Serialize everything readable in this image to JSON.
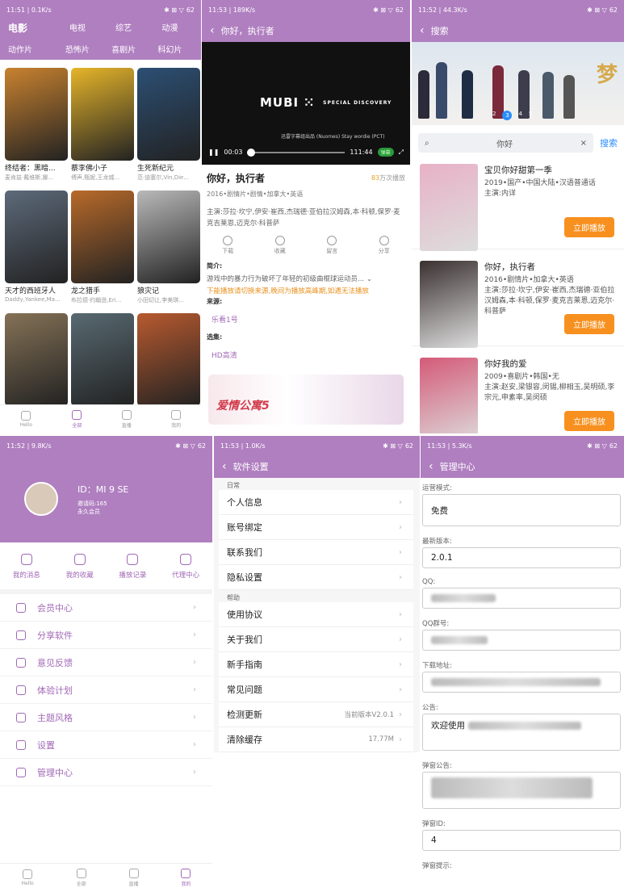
{
  "status": {
    "p1_left": "11:51 | 0.1K/s",
    "p2_left": "11:53 | 189K/s",
    "p3_left": "11:52 | 44.3K/s",
    "p4_left": "11:52 | 9.8K/s",
    "p5_left": "11:53 | 1.0K/s",
    "p6_left": "11:53 | 5.3K/s",
    "battery": "62"
  },
  "home": {
    "categories": [
      "电影",
      "电视",
      "综艺",
      "动漫",
      "动作片",
      "恐怖片",
      "喜剧片",
      "科幻片"
    ],
    "movies": [
      {
        "title": "终结者：黑暗...",
        "sub": "麦肯兹·戴维斯,娜...",
        "color": "#c9822f"
      },
      {
        "title": "蔡李佛小子",
        "sub": "傅声,甄妮,王龙威...",
        "color": "#e6b52a"
      },
      {
        "title": "生死新纪元",
        "sub": "范·迪塞尔,Vin,Die...",
        "color": "#2c4f74"
      },
      {
        "title": "天才的西班牙人",
        "sub": "Daddy,Yankee,Ma...",
        "color": "#5d6a7a"
      },
      {
        "title": "龙之猎手",
        "sub": "布拉德·约翰逊,Eri...",
        "color": "#b86a2a"
      },
      {
        "title": "狼灾记",
        "sub": "小田切让,李美琪...",
        "color": "#b9b9b9"
      },
      {
        "title": "",
        "sub": "",
        "color": "#857256"
      },
      {
        "title": "",
        "sub": "",
        "color": "#586a72"
      },
      {
        "title": "",
        "sub": "",
        "color": "#b85a2f"
      }
    ],
    "nav": [
      "Hello",
      "全部",
      "直播",
      "我的"
    ]
  },
  "player": {
    "back_title": "你好，执行者",
    "logo": "MUBI",
    "logo_sub": "SPECIAL DISCOVERY",
    "video_sub": "迅雷字幕组出品 (Nuomes) Stay wordie (PCT)",
    "time_cur": "00:03",
    "time_total": "111:44",
    "danmaku": "弹幕",
    "name": "你好，执行者",
    "views_num": "83",
    "views_unit": "万次播放",
    "meta": "2016•剧情片•剧情•加拿大•英语",
    "cast": "主演:莎拉·坎宁,伊安·崔西,杰瑞德·亚伯拉汉姆森,本·科顿,保罗·麦克吉莱恩,迈克尔·科普萨",
    "actions": [
      "下载",
      "收藏",
      "留言",
      "分享"
    ],
    "intro_label": "简介:",
    "intro": "游戏中的暴力行为破坏了年轻的初级曲棍球运动员...",
    "warning": "下能播放请切换来源,晚间为播放高峰期,如遇无法播放",
    "source_label": "来源:",
    "source": "乐看1号",
    "episodes_label": "选集:",
    "episode": "HD高清",
    "banner": "爱情公寓5"
  },
  "search": {
    "back_title": "搜索",
    "hero_text": "梦",
    "dot_active": "3",
    "dots": [
      "2",
      "3",
      "4",
      "5"
    ],
    "query": "你好",
    "button": "搜索",
    "results": [
      {
        "title": "宝贝你好甜第一季",
        "meta": "2019•国产•中国大陆•汉语普通话",
        "cast": "主演:内详",
        "btn": "立即播放",
        "color": "#e8b1c6"
      },
      {
        "title": "你好，执行者",
        "meta": "2016•剧情片•加拿大•英语",
        "cast": "主演:莎拉·坎宁,伊安·崔西,杰瑞德·亚伯拉汉姆森,本·科顿,保罗·麦克吉莱恩,迈克尔·科普萨",
        "btn": "立即播放",
        "color": "#3a3030"
      },
      {
        "title": "你好我的爱",
        "meta": "2009•喜剧片•韩国•无",
        "cast": "主演:赵安,梁银容,闵锡,柳相玉,吴明硕,李宗元,申素率,吴闵硕",
        "btn": "立即播放",
        "color": "#d45a78"
      }
    ]
  },
  "profile": {
    "id": "ID：MI 9 SE",
    "invite": "邀请码:165",
    "member": "永久会员",
    "quick": [
      "我的消息",
      "我的收藏",
      "播放记录",
      "代理中心"
    ],
    "menu": [
      "会员中心",
      "分享软件",
      "意见反馈",
      "体验计划",
      "主题风格",
      "设置",
      "管理中心"
    ],
    "nav": [
      "Hello",
      "全部",
      "直播",
      "我的"
    ]
  },
  "settings": {
    "title": "软件设置",
    "group1": "日常",
    "items1": [
      "个人信息",
      "账号绑定",
      "联系我们",
      "隐私设置"
    ],
    "group2": "帮助",
    "items2": [
      {
        "label": "使用协议",
        "value": ""
      },
      {
        "label": "关于我们",
        "value": ""
      },
      {
        "label": "新手指南",
        "value": ""
      },
      {
        "label": "常见问题",
        "value": ""
      },
      {
        "label": "检测更新",
        "value": "当前版本V2.0.1"
      },
      {
        "label": "清除缓存",
        "value": "17.77M"
      }
    ]
  },
  "admin": {
    "title": "管理中心",
    "fields": {
      "mode_label": "运营模式:",
      "mode": "免费",
      "version_label": "最新版本:",
      "version": "2.0.1",
      "qq_label": "QQ:",
      "qqgroup_label": "QQ群号:",
      "download_label": "下载地址:",
      "notice_label": "公告:",
      "notice": "欢迎使用",
      "popup_label": "弹窗公告:",
      "popup_id_label": "弹窗ID:",
      "popup_id": "4",
      "popup_tip_label": "弹窗提示:"
    }
  }
}
